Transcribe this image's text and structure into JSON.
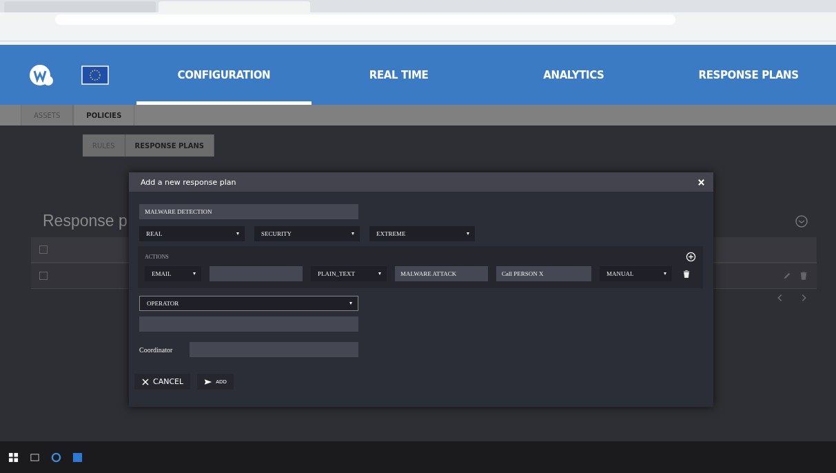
{
  "browser": {
    "tabs": [
      {
        "selected": false
      },
      {
        "selected": true
      }
    ]
  },
  "nav": [
    {
      "label": "CONFIGURATION",
      "selected": true
    },
    {
      "label": "REAL TIME",
      "selected": false
    },
    {
      "label": "ANALYTICS",
      "selected": false
    },
    {
      "label": "RESPONSE PLANS",
      "selected": false
    }
  ],
  "subnav": [
    {
      "label": "ASSETS",
      "selected": false
    },
    {
      "label": "POLICIES",
      "selected": true
    }
  ],
  "policy_tabs": [
    {
      "label": "RULES",
      "selected": false
    },
    {
      "label": "RESPONSE PLANS",
      "selected": true
    }
  ],
  "page": {
    "title": "Response p"
  },
  "table": {
    "header": {
      "checked": false
    },
    "rows": [
      {
        "checked": false
      }
    ]
  },
  "dialog": {
    "title": "Add a new response plan",
    "name": "MALWARE DETECTION",
    "selects": [
      "REAL",
      "SECURITY",
      "EXTREME"
    ],
    "actions_label": "ACTIONS",
    "actions": [
      {
        "channel": "EMAIL",
        "format": "PLAIN_TEXT",
        "subject": "MALWARE ATTACK",
        "message": "Call PERSON X",
        "mode": "MANUAL"
      }
    ],
    "operator": "OPERATOR",
    "coordinator_label": "Coordinator",
    "buttons": [
      {
        "label": "CANCEL",
        "kind": "cancel"
      },
      {
        "label": "ADD",
        "kind": "add"
      }
    ]
  }
}
